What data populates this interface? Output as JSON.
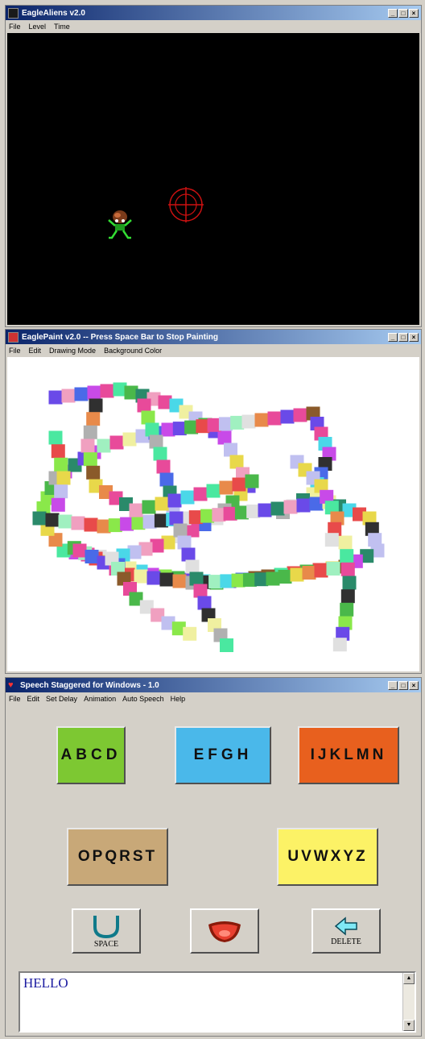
{
  "eaglealiens": {
    "title": "EagleAliens v2.0",
    "menu": [
      "File",
      "Level",
      "Time"
    ]
  },
  "eaglepaint": {
    "title": "EaglePaint v2.0 -- Press Space Bar to Stop Painting",
    "menu": [
      "File",
      "Edit",
      "Drawing Mode",
      "Background Color"
    ],
    "background": "#ffffff"
  },
  "speech": {
    "title": "Speech Staggered for Windows - 1.0",
    "menu": [
      "File",
      "Edit",
      "Set Delay",
      "Animation",
      "Auto Speech",
      "Help"
    ],
    "letter_groups": [
      {
        "label": "ABCD",
        "color": "#7dc832"
      },
      {
        "label": "EFGH",
        "color": "#4ab8ea"
      },
      {
        "label": "IJKLMN",
        "color": "#e8601e"
      },
      {
        "label": "OPQRST",
        "color": "#c8a878"
      },
      {
        "label": "UVWXYZ",
        "color": "#fcf266"
      }
    ],
    "space_label": "SPACE",
    "delete_label": "DELETE",
    "text": "HELLO"
  },
  "window_buttons": {
    "minimize": "_",
    "maximize": "□",
    "close": "×"
  },
  "colors": {
    "titlebar": "#0a246a",
    "crosshair": "#cc1111",
    "alien": "#22bb22"
  }
}
